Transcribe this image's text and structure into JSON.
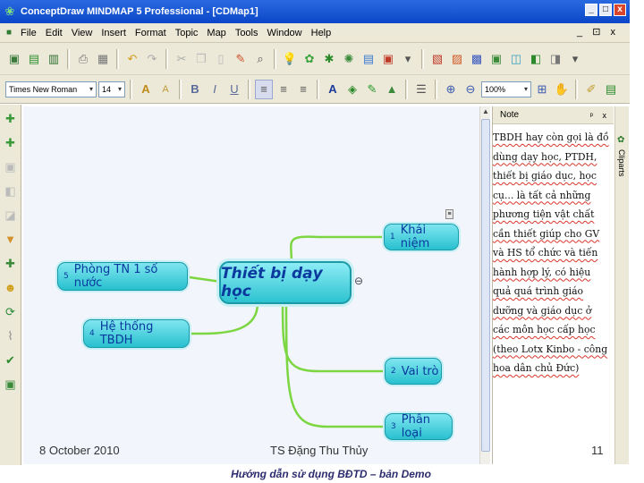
{
  "window": {
    "title": "ConceptDraw MINDMAP 5 Professional - [CDMap1]",
    "controls": [
      "_",
      "□",
      "x"
    ]
  },
  "menu": {
    "items": [
      "File",
      "Edit",
      "View",
      "Insert",
      "Format",
      "Topic",
      "Map",
      "Tools",
      "Window",
      "Help"
    ],
    "right_controls": "_ ⊡ x"
  },
  "toolbar": {
    "font_name": "Times New Roman",
    "font_size": "14",
    "zoom": "100%"
  },
  "mindmap": {
    "central": "Thiết bị dạy học",
    "topics": [
      {
        "num": "1",
        "label": "Khái niệm"
      },
      {
        "num": "2",
        "label": "Vai trò"
      },
      {
        "num": "3",
        "label": "Phân loại"
      },
      {
        "num": "4",
        "label": "Hệ thống TBDH"
      },
      {
        "num": "5",
        "label": "Phòng TN 1 số nước"
      }
    ],
    "colors": {
      "node_fill": "#2dc3d0",
      "node_text": "#0a3a9e",
      "branch": "#7cd642"
    }
  },
  "note_panel": {
    "title": "Note",
    "controls": "ᵖ x",
    "text": "TBDH hay còn gọi là đồ dùng dạy học, PTDH, thiết bị giáo dục, học cụ... là tất cả những phương tiện vật chất cần thiết giúp cho GV và HS tổ chức và tiến hành hợp lý, có hiệu quả quá trình giáo dưỡng và giáo dục ở các môn  học cấp học (theo Lotx Kinbo - công hoa dân chủ Đức)"
  },
  "side_tab": {
    "label": "Cliparts"
  },
  "slide_footer": {
    "date": "8 October 2010",
    "author": "TS Đặng Thu Thủy",
    "page": "11",
    "caption": "Hướng dẫn sử dụng BĐTD – bản Demo"
  }
}
